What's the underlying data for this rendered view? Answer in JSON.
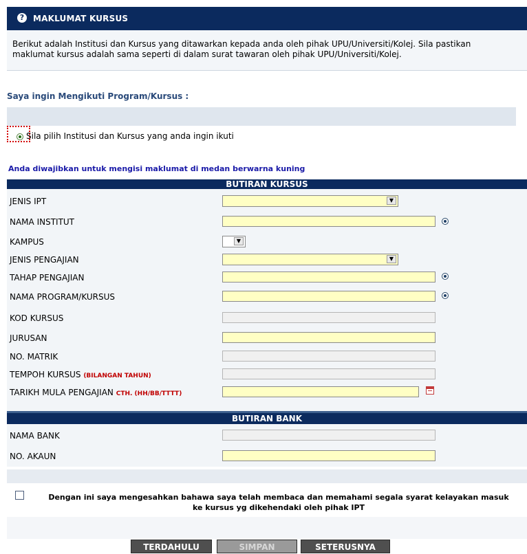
{
  "header": {
    "title": "MAKLUMAT KURSUS",
    "icon": "question-icon"
  },
  "intro": "Berikut adalah Institusi dan Kursus yang ditawarkan kepada anda oleh pihak UPU/Universiti/Kolej. Sila pastikan maklumat kursus adalah sama seperti di dalam surat tawaran oleh pihak UPU/Universiti/Kolej.",
  "program_section": {
    "title": "Saya ingin Mengikuti Program/Kursus :",
    "radio_label": "Sila pilih Institusi dan Kursus yang anda ingin ikuti"
  },
  "notice": "Anda diwajibkan untuk mengisi maklumat di medan berwarna kuning",
  "course": {
    "title": "BUTIRAN KURSUS",
    "jenis_ipt": "JENIS IPT",
    "nama_institut": "NAMA INSTITUT",
    "kampus": "KAMPUS",
    "jenis_pengajian": "JENIS PENGAJIAN",
    "tahap_pengajian": "TAHAP PENGAJIAN",
    "nama_program": "NAMA PROGRAM/KURSUS",
    "kod_kursus": "KOD KURSUS",
    "jurusan": "JURUSAN",
    "no_matrik": "NO. MATRIK",
    "tempoh_kursus": "TEMPOH KURSUS",
    "tempoh_note": "(BILANGAN TAHUN)",
    "tarikh_mula": "TARIKH MULA PENGAJIAN",
    "tarikh_note": "CTH. (HH/BB/TTTT)"
  },
  "bank": {
    "title": "BUTIRAN BANK",
    "nama_bank": "NAMA BANK",
    "no_akaun": "NO. AKAUN"
  },
  "agreement": {
    "line1": "Dengan ini saya mengesahkan bahawa saya telah membaca dan memahami segala syarat kelayakan masuk",
    "line2": "ke kursus yg dikehendaki oleh pihak IPT"
  },
  "buttons": {
    "back": "TERDAHULU",
    "save": "SIMPAN",
    "next": "SETERUSNYA"
  },
  "colors": {
    "header": "#0b2a5e",
    "required": "#ffffc4",
    "readonly": "#f0f0f0"
  }
}
